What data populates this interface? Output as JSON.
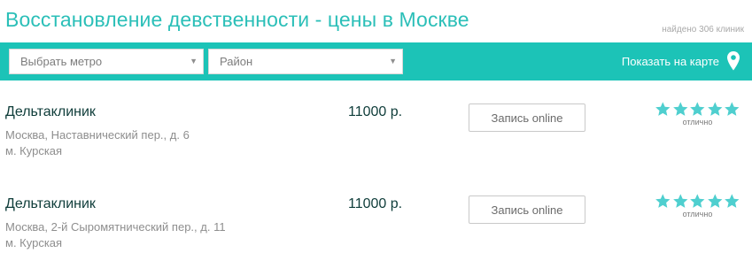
{
  "header": {
    "title": "Восстановление девственности - цены в Москве",
    "found_count": "найдено 306 клиник"
  },
  "filters": {
    "metro_select": "Выбрать метро",
    "district_select": "Район",
    "show_on_map": "Показать на карте",
    "map_icon": "map-pin-icon",
    "bar_color": "#1cc3b7"
  },
  "colors": {
    "accent": "#2bbfb8",
    "star": "#4fcfcf"
  },
  "clinics": [
    {
      "name": "Дельтаклиник",
      "address": "Москва, Наставнический пер., д. 6",
      "metro": "м. Курская",
      "price": "11000 р.",
      "book_label": "Запись online",
      "rating_stars": 5,
      "rating_label": "отлично"
    },
    {
      "name": "Дельтаклиник",
      "address": "Москва, 2-й Сыромятнический пер., д. 11",
      "metro": "м. Курская",
      "price": "11000 р.",
      "book_label": "Запись online",
      "rating_stars": 5,
      "rating_label": "отлично"
    }
  ]
}
